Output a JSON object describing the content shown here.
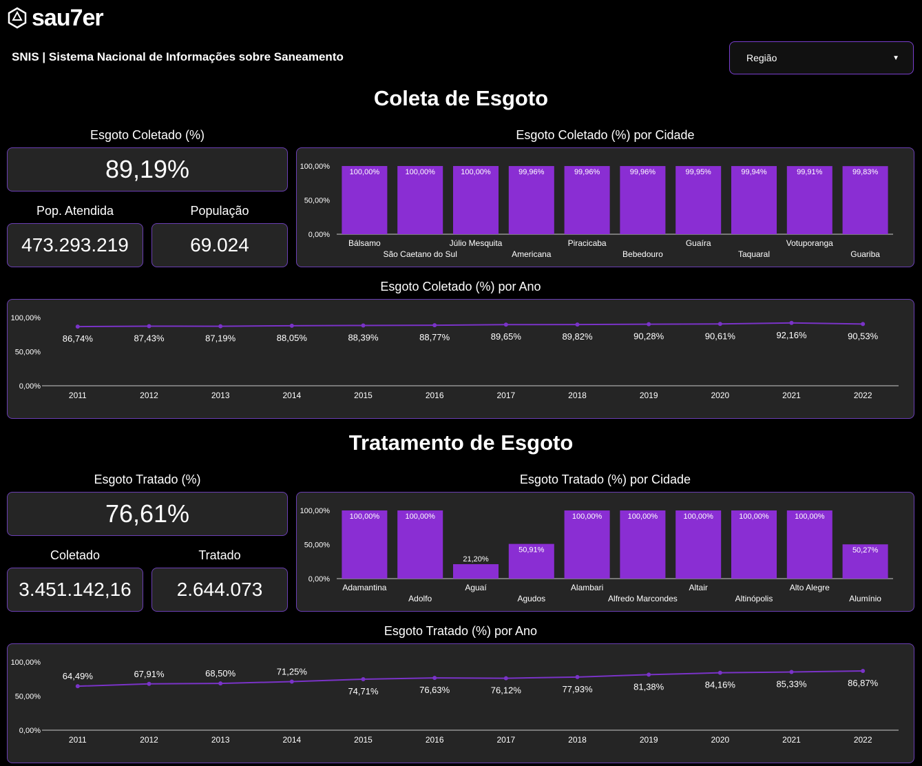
{
  "brand": {
    "logo_text": "sau7er"
  },
  "header": {
    "subtitle": "SNIS | Sistema Nacional de Informações sobre Saneamento",
    "filter_label": "Região"
  },
  "colors": {
    "accent": "#8a2ed3",
    "line": "#7a33c8",
    "card_bg": "#252525",
    "border": "#6b3fb5"
  },
  "coleta": {
    "section_title": "Coleta de Esgoto",
    "kpi_title": "Esgoto Coletado (%)",
    "kpi_value": "89,19%",
    "kpi2_title": "Pop. Atendida",
    "kpi2_value": "473.293.219",
    "kpi3_title": "População",
    "kpi3_value": "69.024",
    "bar_title": "Esgoto Coletado (%) por Cidade",
    "line_title": "Esgoto Coletado (%) por Ano"
  },
  "tratamento": {
    "section_title": "Tratamento de Esgoto",
    "kpi_title": "Esgoto Tratado (%)",
    "kpi_value": "76,61%",
    "kpi2_title": "Coletado",
    "kpi2_value": "3.451.142,16",
    "kpi3_title": "Tratado",
    "kpi3_value": "2.644.073",
    "bar_title": "Esgoto Tratado (%) por Cidade",
    "line_title": "Esgoto Tratado (%) por Ano"
  },
  "chart_data": [
    {
      "id": "coleta-bar",
      "type": "bar",
      "categories": [
        "Bálsamo",
        "São Caetano do Sul",
        "Júlio Mesquita",
        "Americana",
        "Piracicaba",
        "Bebedouro",
        "Guaíra",
        "Taquaral",
        "Votuporanga",
        "Guariba"
      ],
      "values": [
        100.0,
        100.0,
        100.0,
        99.96,
        99.96,
        99.96,
        99.95,
        99.94,
        99.91,
        99.83
      ],
      "labels": [
        "100,00%",
        "100,00%",
        "100,00%",
        "99,96%",
        "99,96%",
        "99,96%",
        "99,95%",
        "99,94%",
        "99,91%",
        "99,83%"
      ],
      "yticks": [
        "0,00%",
        "50,00%",
        "100,00%"
      ],
      "ylim": [
        0,
        100
      ]
    },
    {
      "id": "coleta-line",
      "type": "line",
      "x": [
        "2011",
        "2012",
        "2013",
        "2014",
        "2015",
        "2016",
        "2017",
        "2018",
        "2019",
        "2020",
        "2021",
        "2022"
      ],
      "values": [
        86.74,
        87.43,
        87.19,
        88.05,
        88.39,
        88.77,
        89.65,
        89.82,
        90.28,
        90.61,
        92.16,
        90.53
      ],
      "labels": [
        "86,74%",
        "87,43%",
        "87,19%",
        "88,05%",
        "88,39%",
        "88,77%",
        "89,65%",
        "89,82%",
        "90,28%",
        "90,61%",
        "92,16%",
        "90,53%"
      ],
      "yticks": [
        "0,00%",
        "50,00%",
        "100,00%"
      ],
      "ylim": [
        0,
        100
      ]
    },
    {
      "id": "tratado-bar",
      "type": "bar",
      "categories": [
        "Adamantina",
        "Adolfo",
        "Aguaí",
        "Agudos",
        "Alambari",
        "Alfredo Marcondes",
        "Altair",
        "Altinópolis",
        "Alto Alegre",
        "Alumínio"
      ],
      "values": [
        100.0,
        100.0,
        21.2,
        50.91,
        100.0,
        100.0,
        100.0,
        100.0,
        100.0,
        50.27
      ],
      "labels": [
        "100,00%",
        "100,00%",
        "21,20%",
        "50,91%",
        "100,00%",
        "100,00%",
        "100,00%",
        "100,00%",
        "100,00%",
        "50,27%"
      ],
      "yticks": [
        "0,00%",
        "50,00%",
        "100,00%"
      ],
      "ylim": [
        0,
        100
      ]
    },
    {
      "id": "tratado-line",
      "type": "line",
      "x": [
        "2011",
        "2012",
        "2013",
        "2014",
        "2015",
        "2016",
        "2017",
        "2018",
        "2019",
        "2020",
        "2021",
        "2022"
      ],
      "values": [
        64.49,
        67.91,
        68.5,
        71.25,
        74.71,
        76.63,
        76.12,
        77.93,
        81.38,
        84.16,
        85.33,
        86.87
      ],
      "labels": [
        "64,49%",
        "67,91%",
        "68,50%",
        "71,25%",
        "74,71%",
        "76,63%",
        "76,12%",
        "77,93%",
        "81,38%",
        "84,16%",
        "85,33%",
        "86,87%"
      ],
      "yticks": [
        "0,00%",
        "50,00%",
        "100,00%"
      ],
      "ylim": [
        0,
        100
      ]
    }
  ]
}
